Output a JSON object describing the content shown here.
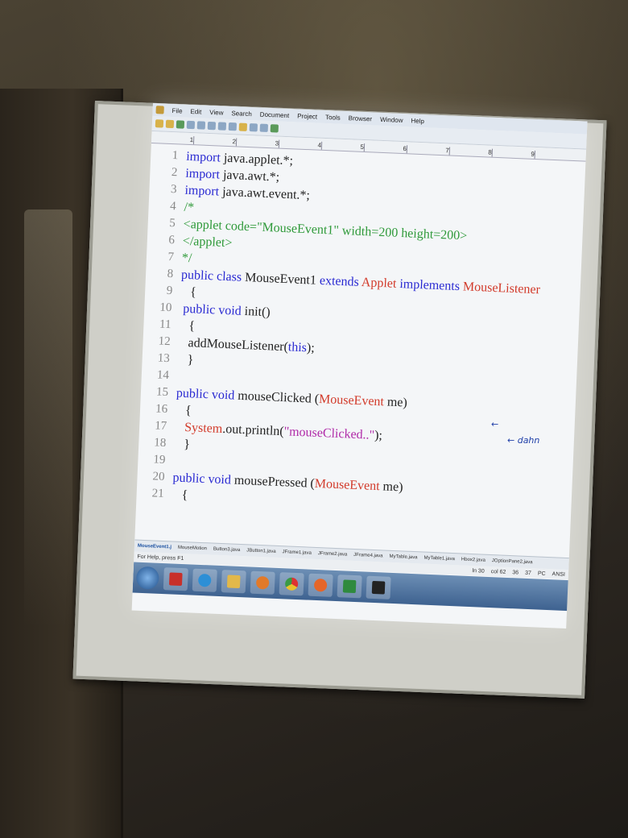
{
  "menu": [
    "File",
    "Edit",
    "View",
    "Search",
    "Document",
    "Project",
    "Tools",
    "Browser",
    "Window",
    "Help"
  ],
  "ruler": [
    "1",
    "2",
    "3",
    "4",
    "5",
    "6",
    "7",
    "8",
    "9"
  ],
  "code_lines": [
    {
      "n": "1",
      "parts": [
        {
          "t": "import",
          "c": "kw"
        },
        {
          "t": " java.applet.*;",
          "c": ""
        }
      ]
    },
    {
      "n": "2",
      "parts": [
        {
          "t": "import",
          "c": "kw"
        },
        {
          "t": " java.awt.*;",
          "c": ""
        }
      ]
    },
    {
      "n": "3",
      "parts": [
        {
          "t": "import",
          "c": "kw"
        },
        {
          "t": " java.awt.event.*;",
          "c": ""
        }
      ]
    },
    {
      "n": "4",
      "parts": [
        {
          "t": "/*",
          "c": "cm"
        }
      ]
    },
    {
      "n": "5",
      "parts": [
        {
          "t": "<applet code=\"MouseEvent1\" width=200 height=200>",
          "c": "cm"
        }
      ]
    },
    {
      "n": "6",
      "parts": [
        {
          "t": "</applet>",
          "c": "cm"
        }
      ]
    },
    {
      "n": "7",
      "parts": [
        {
          "t": "*/",
          "c": "cm"
        }
      ]
    },
    {
      "n": "8",
      "parts": [
        {
          "t": "public class",
          "c": "kw"
        },
        {
          "t": " MouseEvent1 ",
          "c": ""
        },
        {
          "t": "extends",
          "c": "kw"
        },
        {
          "t": " Applet ",
          "c": "cls"
        },
        {
          "t": "implements",
          "c": "kw"
        },
        {
          "t": " MouseListener",
          "c": "cls"
        }
      ]
    },
    {
      "n": "9",
      "parts": [
        {
          "t": "   {",
          "c": ""
        }
      ]
    },
    {
      "n": "10",
      "parts": [
        {
          "t": " public void",
          "c": "kw"
        },
        {
          "t": " init()",
          "c": ""
        }
      ]
    },
    {
      "n": "11",
      "parts": [
        {
          "t": "   {",
          "c": ""
        }
      ]
    },
    {
      "n": "12",
      "parts": [
        {
          "t": "   addMouseListener(",
          "c": ""
        },
        {
          "t": "this",
          "c": "kw"
        },
        {
          "t": ");",
          "c": ""
        }
      ]
    },
    {
      "n": "13",
      "parts": [
        {
          "t": "   }",
          "c": ""
        }
      ]
    },
    {
      "n": "14",
      "parts": []
    },
    {
      "n": "15",
      "parts": [
        {
          "t": "public void",
          "c": "kw"
        },
        {
          "t": " mouseClicked (",
          "c": ""
        },
        {
          "t": "MouseEvent",
          "c": "cls"
        },
        {
          "t": " me)",
          "c": ""
        }
      ]
    },
    {
      "n": "16",
      "parts": [
        {
          "t": "   {",
          "c": ""
        }
      ]
    },
    {
      "n": "17",
      "parts": [
        {
          "t": "   System",
          "c": "cls"
        },
        {
          "t": ".out.println(",
          "c": ""
        },
        {
          "t": "\"mouseClicked..\"",
          "c": "str"
        },
        {
          "t": ");",
          "c": ""
        }
      ]
    },
    {
      "n": "18",
      "parts": [
        {
          "t": "   }",
          "c": ""
        }
      ]
    },
    {
      "n": "19",
      "parts": []
    },
    {
      "n": "20",
      "parts": [
        {
          "t": "public void",
          "c": "kw"
        },
        {
          "t": " mousePressed (",
          "c": ""
        },
        {
          "t": "MouseEvent",
          "c": "cls"
        },
        {
          "t": " me)",
          "c": ""
        }
      ]
    },
    {
      "n": "21",
      "parts": [
        {
          "t": "   {",
          "c": ""
        }
      ]
    }
  ],
  "file_tabs": [
    "MouseEvent1.j",
    "MouseMotion",
    "Button3.java",
    "JButton1.java",
    "JFrame1.java",
    "JFrame2.java",
    "JFrame4.java",
    "MyTable.java",
    "MyTable1.java",
    "Hbox2.java",
    "JOptionPane2.java"
  ],
  "status": {
    "help": "For Help, press F1",
    "ln": "ln 30",
    "col": "col 62",
    "n1": "36",
    "n2": "37",
    "pc": "PC",
    "enc": "ANSI"
  },
  "annotation": {
    "arrow1": "←",
    "text": "← dahn"
  },
  "colors": {
    "keyword": "#2a2ad2",
    "class": "#d23a2a",
    "comment": "#2f9a3a",
    "string": "#b02aa8"
  }
}
